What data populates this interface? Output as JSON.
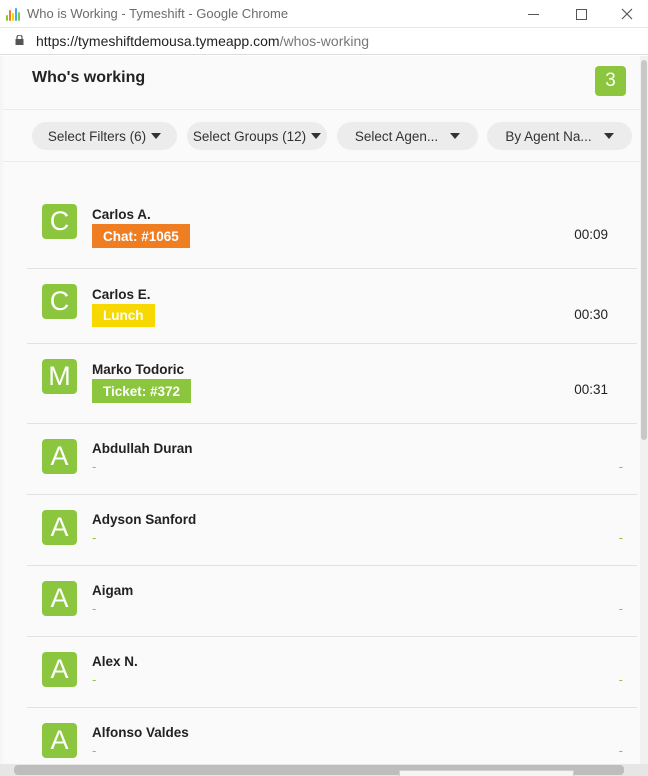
{
  "window": {
    "title": "Who is Working - Tymeshift - Google Chrome",
    "url_host": "https://tymeshiftdemousa.tymeapp.com",
    "url_path": "/whos-working"
  },
  "header": {
    "title": "Who's working",
    "count": "3"
  },
  "filters": {
    "filters_label": "Select Filters (6)",
    "groups_label": "Select Groups (12)",
    "agents_label": "Select Agen...",
    "sort_label": "By Agent Na..."
  },
  "colors": {
    "accent_green": "#8cc63f",
    "chat_orange": "#ef7d22",
    "lunch_yellow": "#f7d800",
    "ticket_green": "#8cc63f"
  },
  "agents": [
    {
      "initial": "C",
      "name": "Carlos A.",
      "status": "Chat: #1065",
      "status_type": "chat",
      "duration": "00:09"
    },
    {
      "initial": "C",
      "name": "Carlos E.",
      "status": "Lunch",
      "status_type": "lunch",
      "duration": "00:30"
    },
    {
      "initial": "M",
      "name": "Marko Todoric",
      "status": "Ticket: #372",
      "status_type": "ticket",
      "duration": "00:31"
    },
    {
      "initial": "A",
      "name": "Abdullah Duran",
      "status": "-",
      "status_type": "none",
      "duration": "-"
    },
    {
      "initial": "A",
      "name": "Adyson Sanford",
      "status": "-",
      "status_type": "none",
      "duration": "-"
    },
    {
      "initial": "A",
      "name": "Aigam",
      "status": "-",
      "status_type": "none",
      "duration": "-"
    },
    {
      "initial": "A",
      "name": "Alex N.",
      "status": "-",
      "status_type": "none",
      "duration": "-"
    },
    {
      "initial": "A",
      "name": "Alfonso Valdes",
      "status": "-",
      "status_type": "none",
      "duration": "-"
    }
  ]
}
